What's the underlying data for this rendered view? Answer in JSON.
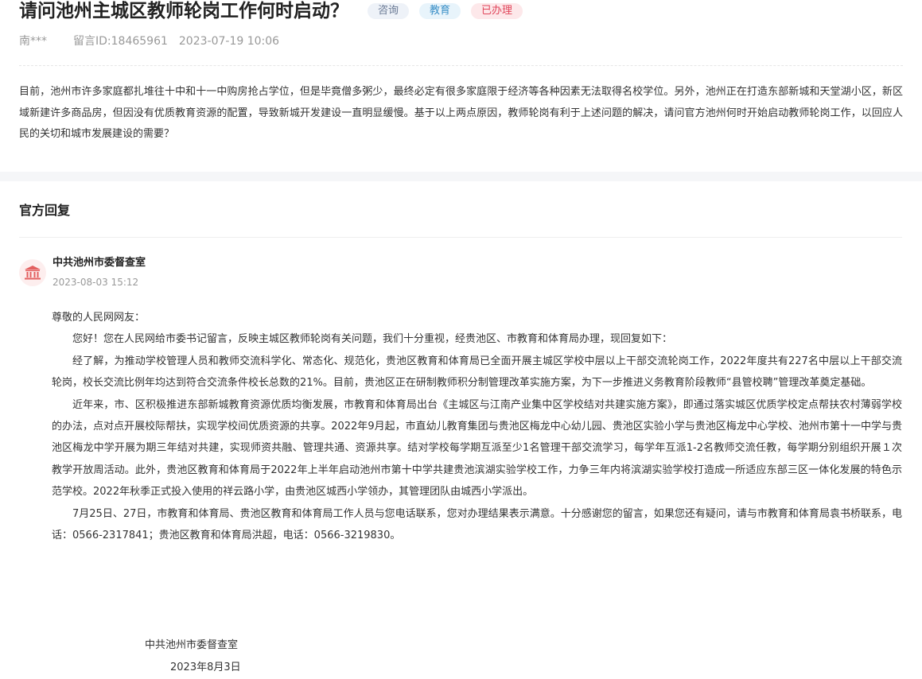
{
  "question": {
    "title": "请问池州主城区教师轮岗工作何时启动？",
    "tags": {
      "consult": "咨询",
      "category": "教育",
      "status": "已办理"
    },
    "author": "南***",
    "message_id": "留言ID:18465961",
    "datetime": "2023-07-19 10:06",
    "body": "目前，池州市许多家庭都扎堆往十中和十一中购房抢占学位，但是毕竟僧多粥少，最终必定有很多家庭限于经济等各种因素无法取得名校学位。另外，池州正在打造东部新城和天堂湖小区，新区域新建许多商品房，但因没有优质教育资源的配置，导致新城开发建设一直明显缓慢。基于以上两点原因，教师轮岗有利于上述问题的解决，请问官方池州何时开始启动教师轮岗工作，以回应人民的关切和城市发展建设的需要？"
  },
  "reply": {
    "heading": "官方回复",
    "org_icon": "government-building-icon",
    "org_name": "中共池州市委督查室",
    "org_datetime": "2023-08-03 15:12",
    "greeting": "尊敬的人民网网友：",
    "paragraphs": [
      "您好！您在人民网给市委书记留言，反映主城区教师轮岗有关问题，我们十分重视，经贵池区、市教育和体育局办理，现回复如下：",
      "经了解，为推动学校管理人员和教师交流科学化、常态化、规范化，贵池区教育和体育局已全面开展主城区学校中层以上干部交流轮岗工作，2022年度共有227名中层以上干部交流轮岗，校长交流比例年均达到符合交流条件校长总数的21%。目前，贵池区正在研制教师积分制管理改革实施方案，为下一步推进义务教育阶段教师“县管校聘”管理改革奠定基础。",
      "近年来，市、区积极推进东部新城教育资源优质均衡发展，市教育和体育局出台《主城区与江南产业集中区学校结对共建实施方案》，即通过落实城区优质学校定点帮扶农村薄弱学校的办法，点对点开展校际帮扶，实现学校间优质资源的共享。2022年9月起，市直幼儿教育集团与贵池区梅龙中心幼儿园、贵池区实验小学与贵池区梅龙中心学校、池州市第十一中学与贵池区梅龙中学开展为期三年结对共建，实现师资共融、管理共通、资源共享。结对学校每学期互派至少1名管理干部交流学习，每学年互派1-2名教师交流任教，每学期分别组织开展１次教学开放周活动。此外，贵池区教育和体育局于2022年上半年启动池州市第十中学共建贵池滨湖实验学校工作，力争三年内将滨湖实验学校打造成一所适应东部三区一体化发展的特色示范学校。2022年秋季正式投入使用的祥云路小学，由贵池区城西小学领办，其管理团队由城西小学派出。",
      "7月25日、27日，市教育和体育局、贵池区教育和体育局工作人员与您电话联系，您对办理结果表示满意。十分感谢您的留言，如果您还有疑问，请与市教育和体育局袁书桥联系，电话：0566-2317841；贵池区教育和体育局洪超，电话：0566-3219830。"
    ],
    "signature_org": "中共池州市委督查室",
    "signature_date": "2023年8月3日"
  },
  "colors": {
    "tag_consult_bg": "#eef2f8",
    "tag_edu_text": "#3a8fc7",
    "tag_done_text": "#e0455a",
    "org_icon_color": "#e36060"
  }
}
